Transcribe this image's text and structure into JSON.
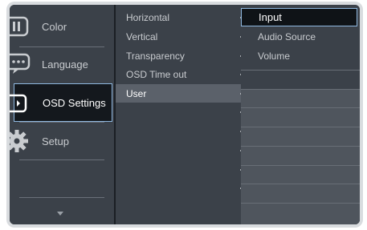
{
  "sidebar": {
    "items": [
      {
        "label": "Color",
        "icon": "color-icon"
      },
      {
        "label": "Language",
        "icon": "language-icon"
      },
      {
        "label": "OSD Settings",
        "icon": "osd-settings-icon",
        "active": true
      },
      {
        "label": "Setup",
        "icon": "gear-icon"
      }
    ],
    "more_icon": "chevron-down-icon"
  },
  "submenu": {
    "items": [
      {
        "label": "Horizontal"
      },
      {
        "label": "Vertical"
      },
      {
        "label": "Transparency"
      },
      {
        "label": "OSD Time out"
      },
      {
        "label": "User",
        "active": true
      }
    ]
  },
  "options": {
    "items": [
      {
        "label": "Input",
        "selected": true
      },
      {
        "label": "Audio Source"
      },
      {
        "label": "Volume"
      }
    ]
  },
  "colors": {
    "background": "#3b4149",
    "highlight_border": "#8fb8e0",
    "selected_bg": "#14181d"
  }
}
